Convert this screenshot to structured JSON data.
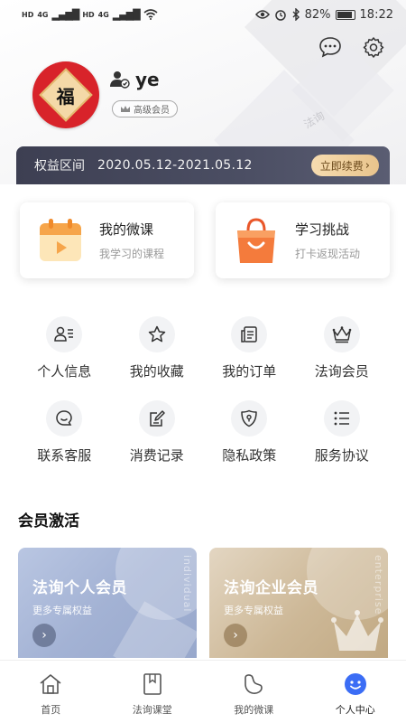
{
  "status_bar": {
    "left_labels": [
      "HD",
      "4G",
      "HD",
      "4G"
    ],
    "battery_percent": "82%",
    "battery_level": 0.82,
    "time": "18:22"
  },
  "profile": {
    "avatar_char": "福",
    "username": "ye",
    "member_level": "高级会员",
    "bg_watermark": "法询"
  },
  "privilege": {
    "label": "权益区间",
    "range": "2020.05.12-2021.05.12",
    "renew_label": "立即续费"
  },
  "course_cards": [
    {
      "title": "我的微课",
      "subtitle": "我学习的课程",
      "icon": "calendar-play-icon"
    },
    {
      "title": "学习挑战",
      "subtitle": "打卡返现活动",
      "icon": "shopping-bag-icon"
    }
  ],
  "grid": [
    {
      "label": "个人信息",
      "icon": "user-info-icon"
    },
    {
      "label": "我的收藏",
      "icon": "star-icon"
    },
    {
      "label": "我的订单",
      "icon": "order-icon"
    },
    {
      "label": "法询会员",
      "icon": "crown-icon"
    },
    {
      "label": "联系客服",
      "icon": "chat-icon"
    },
    {
      "label": "消费记录",
      "icon": "edit-record-icon"
    },
    {
      "label": "隐私政策",
      "icon": "shield-icon"
    },
    {
      "label": "服务协议",
      "icon": "list-icon"
    }
  ],
  "membership": {
    "section_title": "会员激活",
    "cards": [
      {
        "title": "法询个人会员",
        "subtitle": "更多专属权益",
        "watermark": "individual"
      },
      {
        "title": "法询企业会员",
        "subtitle": "更多专属权益",
        "watermark": "enterprise"
      }
    ]
  },
  "tabs": [
    {
      "label": "首页",
      "icon": "home-icon"
    },
    {
      "label": "法询课堂",
      "icon": "book-icon"
    },
    {
      "label": "我的微课",
      "icon": "micro-course-icon"
    },
    {
      "label": "个人中心",
      "icon": "smiley-icon"
    }
  ],
  "colors": {
    "privilege_bar": "#3d3f52",
    "renew_gold": "#e9c48c",
    "avatar_red": "#d8232a",
    "active_tab": "#3b6df5",
    "course_orange": "#f47b3c"
  }
}
